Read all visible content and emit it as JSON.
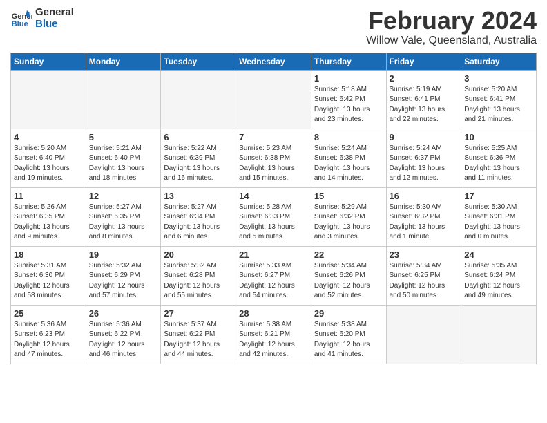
{
  "logo": {
    "line1": "General",
    "line2": "Blue"
  },
  "title": "February 2024",
  "subtitle": "Willow Vale, Queensland, Australia",
  "header": {
    "days": [
      "Sunday",
      "Monday",
      "Tuesday",
      "Wednesday",
      "Thursday",
      "Friday",
      "Saturday"
    ]
  },
  "weeks": [
    {
      "cells": [
        {
          "day": "",
          "empty": true
        },
        {
          "day": "",
          "empty": true
        },
        {
          "day": "",
          "empty": true
        },
        {
          "day": "",
          "empty": true
        },
        {
          "day": "1",
          "detail": "Sunrise: 5:18 AM\nSunset: 6:42 PM\nDaylight: 13 hours\nand 23 minutes."
        },
        {
          "day": "2",
          "detail": "Sunrise: 5:19 AM\nSunset: 6:41 PM\nDaylight: 13 hours\nand 22 minutes."
        },
        {
          "day": "3",
          "detail": "Sunrise: 5:20 AM\nSunset: 6:41 PM\nDaylight: 13 hours\nand 21 minutes."
        }
      ]
    },
    {
      "cells": [
        {
          "day": "4",
          "detail": "Sunrise: 5:20 AM\nSunset: 6:40 PM\nDaylight: 13 hours\nand 19 minutes."
        },
        {
          "day": "5",
          "detail": "Sunrise: 5:21 AM\nSunset: 6:40 PM\nDaylight: 13 hours\nand 18 minutes."
        },
        {
          "day": "6",
          "detail": "Sunrise: 5:22 AM\nSunset: 6:39 PM\nDaylight: 13 hours\nand 16 minutes."
        },
        {
          "day": "7",
          "detail": "Sunrise: 5:23 AM\nSunset: 6:38 PM\nDaylight: 13 hours\nand 15 minutes."
        },
        {
          "day": "8",
          "detail": "Sunrise: 5:24 AM\nSunset: 6:38 PM\nDaylight: 13 hours\nand 14 minutes."
        },
        {
          "day": "9",
          "detail": "Sunrise: 5:24 AM\nSunset: 6:37 PM\nDaylight: 13 hours\nand 12 minutes."
        },
        {
          "day": "10",
          "detail": "Sunrise: 5:25 AM\nSunset: 6:36 PM\nDaylight: 13 hours\nand 11 minutes."
        }
      ]
    },
    {
      "cells": [
        {
          "day": "11",
          "detail": "Sunrise: 5:26 AM\nSunset: 6:35 PM\nDaylight: 13 hours\nand 9 minutes."
        },
        {
          "day": "12",
          "detail": "Sunrise: 5:27 AM\nSunset: 6:35 PM\nDaylight: 13 hours\nand 8 minutes."
        },
        {
          "day": "13",
          "detail": "Sunrise: 5:27 AM\nSunset: 6:34 PM\nDaylight: 13 hours\nand 6 minutes."
        },
        {
          "day": "14",
          "detail": "Sunrise: 5:28 AM\nSunset: 6:33 PM\nDaylight: 13 hours\nand 5 minutes."
        },
        {
          "day": "15",
          "detail": "Sunrise: 5:29 AM\nSunset: 6:32 PM\nDaylight: 13 hours\nand 3 minutes."
        },
        {
          "day": "16",
          "detail": "Sunrise: 5:30 AM\nSunset: 6:32 PM\nDaylight: 13 hours\nand 1 minute."
        },
        {
          "day": "17",
          "detail": "Sunrise: 5:30 AM\nSunset: 6:31 PM\nDaylight: 13 hours\nand 0 minutes."
        }
      ]
    },
    {
      "cells": [
        {
          "day": "18",
          "detail": "Sunrise: 5:31 AM\nSunset: 6:30 PM\nDaylight: 12 hours\nand 58 minutes."
        },
        {
          "day": "19",
          "detail": "Sunrise: 5:32 AM\nSunset: 6:29 PM\nDaylight: 12 hours\nand 57 minutes."
        },
        {
          "day": "20",
          "detail": "Sunrise: 5:32 AM\nSunset: 6:28 PM\nDaylight: 12 hours\nand 55 minutes."
        },
        {
          "day": "21",
          "detail": "Sunrise: 5:33 AM\nSunset: 6:27 PM\nDaylight: 12 hours\nand 54 minutes."
        },
        {
          "day": "22",
          "detail": "Sunrise: 5:34 AM\nSunset: 6:26 PM\nDaylight: 12 hours\nand 52 minutes."
        },
        {
          "day": "23",
          "detail": "Sunrise: 5:34 AM\nSunset: 6:25 PM\nDaylight: 12 hours\nand 50 minutes."
        },
        {
          "day": "24",
          "detail": "Sunrise: 5:35 AM\nSunset: 6:24 PM\nDaylight: 12 hours\nand 49 minutes."
        }
      ]
    },
    {
      "cells": [
        {
          "day": "25",
          "detail": "Sunrise: 5:36 AM\nSunset: 6:23 PM\nDaylight: 12 hours\nand 47 minutes."
        },
        {
          "day": "26",
          "detail": "Sunrise: 5:36 AM\nSunset: 6:22 PM\nDaylight: 12 hours\nand 46 minutes."
        },
        {
          "day": "27",
          "detail": "Sunrise: 5:37 AM\nSunset: 6:22 PM\nDaylight: 12 hours\nand 44 minutes."
        },
        {
          "day": "28",
          "detail": "Sunrise: 5:38 AM\nSunset: 6:21 PM\nDaylight: 12 hours\nand 42 minutes."
        },
        {
          "day": "29",
          "detail": "Sunrise: 5:38 AM\nSunset: 6:20 PM\nDaylight: 12 hours\nand 41 minutes."
        },
        {
          "day": "",
          "empty": true
        },
        {
          "day": "",
          "empty": true
        }
      ]
    }
  ]
}
